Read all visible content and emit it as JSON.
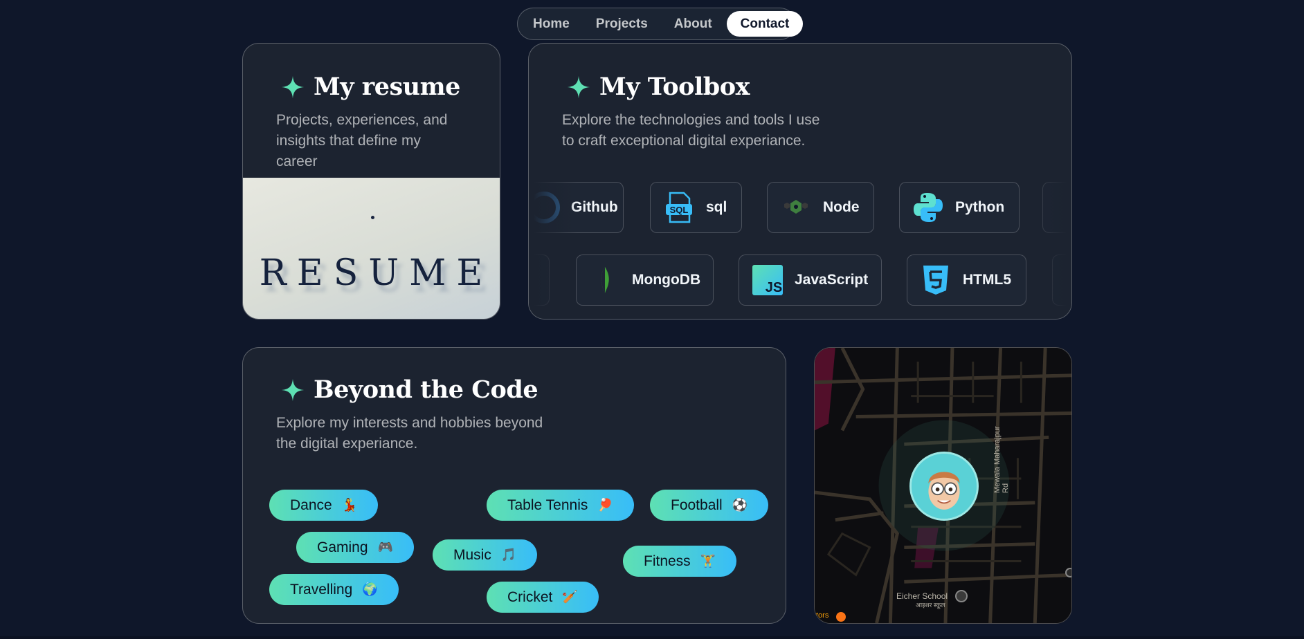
{
  "nav": {
    "items": [
      {
        "label": "Home"
      },
      {
        "label": "Projects"
      },
      {
        "label": "About"
      },
      {
        "label": "Contact"
      }
    ],
    "active": "Contact"
  },
  "resume": {
    "title": "My resume",
    "subtitle_lines": [
      "Projects, experiences, and",
      "insights that define my",
      "career"
    ],
    "image_text": "RESUME"
  },
  "toolbox": {
    "title": "My Toolbox",
    "subtitle_lines": [
      "Explore the technologies and tools I use",
      "to craft exceptional digital experiance."
    ],
    "row1": [
      "Github",
      "sql",
      "Node",
      "Python"
    ],
    "row2": [
      "MongoDB",
      "JavaScript",
      "HTML5"
    ]
  },
  "hobbies": {
    "title": "Beyond the Code",
    "subtitle_lines": [
      "Explore my interests and hobbies beyond",
      "the digital experiance."
    ],
    "items": [
      {
        "label": "Dance",
        "emoji": "💃"
      },
      {
        "label": "Table Tennis",
        "emoji": "🏓"
      },
      {
        "label": "Football",
        "emoji": "⚽"
      },
      {
        "label": "Gaming",
        "emoji": "🎮"
      },
      {
        "label": "Music",
        "emoji": "🎵"
      },
      {
        "label": "Fitness",
        "emoji": "🏋"
      },
      {
        "label": "Travelling",
        "emoji": "🌍"
      },
      {
        "label": "Cricket",
        "emoji": "🏏"
      }
    ]
  },
  "map": {
    "road_label": "Mewala Maharajpur Rd",
    "school_label": "Eicher School",
    "school_hindi": "आइशर स्कूल",
    "edge_label": "tors"
  },
  "colors": {
    "background": "#0f172a",
    "card": "#1c2330",
    "accent_start": "#5ee0b3",
    "accent_end": "#38bdf8"
  },
  "icons": [
    "sparkle-icon",
    "github-icon",
    "sql-icon",
    "node-icon",
    "python-icon",
    "mongodb-icon",
    "javascript-icon",
    "html5-icon"
  ]
}
